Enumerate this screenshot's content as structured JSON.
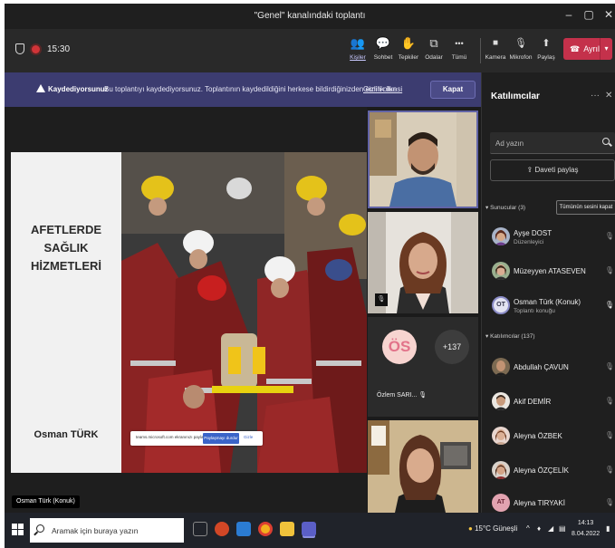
{
  "window": {
    "title": "\"Genel\" kanalındaki toplantı",
    "controls": [
      "–",
      "▢",
      "✕"
    ]
  },
  "toolbar": {
    "timer": "15:30",
    "buttons": [
      {
        "label": "Kişiler",
        "icon": "people-icon",
        "glyph": "👥"
      },
      {
        "label": "Sohbet",
        "icon": "chat-icon",
        "glyph": "💬"
      },
      {
        "label": "Tepkiler",
        "icon": "reactions-icon",
        "glyph": "✋"
      },
      {
        "label": "Odalar",
        "icon": "rooms-icon",
        "glyph": "⧉"
      },
      {
        "label": "Tümü",
        "icon": "more-icon",
        "glyph": "•••"
      },
      {
        "label": "Kamera",
        "icon": "camera-icon",
        "glyph": "■"
      },
      {
        "label": "Mikrofon",
        "icon": "microphone-off-icon",
        "glyph": "🎙"
      },
      {
        "label": "Paylaş",
        "icon": "share-icon",
        "glyph": "⬆"
      }
    ],
    "leave_label": "Ayrıl",
    "leave_color": "#c4314b"
  },
  "banner": {
    "title": "Kaydediyorsunuz",
    "message": "Bu toplantıyı kaydediyorsunuz. Toplantının kaydedildiğini herkese bildirdiğinizden emin olun.",
    "link": "Gizlilik ilkesi",
    "close_label": "Kapat",
    "color": "#3c3c70"
  },
  "slide": {
    "title_line1": "AFETLERDE SAĞLIK",
    "title_line2": "HİZMETLERİ",
    "author": "Osman TÜRK",
    "share_url": "teams.microsoft.com ekranınızı paylaşıyor.",
    "share_stop": "Paylaşmayı durdur",
    "share_hide": "Gizle"
  },
  "stage": {
    "presenter_tag": "Osman Türk (Konuk)"
  },
  "tiles": {
    "ozlem_initials": "ÖS",
    "ozlem_name": "Özlem SARI...",
    "more_count": "+137"
  },
  "panel": {
    "title": "Katılımcılar",
    "search_placeholder": "Ad yazın",
    "invite_label": "Daveti paylaş",
    "presenters_header": "Sunucular (3)",
    "mute_all": "Tümünün sesini kapat",
    "presenters": [
      {
        "name": "Ayşe DOST",
        "role": "Düzenleyici"
      },
      {
        "name": "Müzeyyen ATASEVEN",
        "role": ""
      },
      {
        "name": "Osman Türk (Konuk)",
        "role": "Toplantı konuğu",
        "initials": "OT"
      }
    ],
    "attendees_header": "Katılımcılar (137)",
    "attendees": [
      {
        "name": "Abdullah ÇAVUN"
      },
      {
        "name": "Akif DEMİR"
      },
      {
        "name": "Aleyna ÖZBEK"
      },
      {
        "name": "Aleyna ÖZÇELİK"
      },
      {
        "name": "Aleyna TIRYAKİ",
        "initials": "AT"
      }
    ]
  },
  "taskbar": {
    "search_placeholder": "Aramak için buraya yazın",
    "weather": "15°C  Güneşli",
    "time": "14:13",
    "date": "8.04.2022"
  }
}
